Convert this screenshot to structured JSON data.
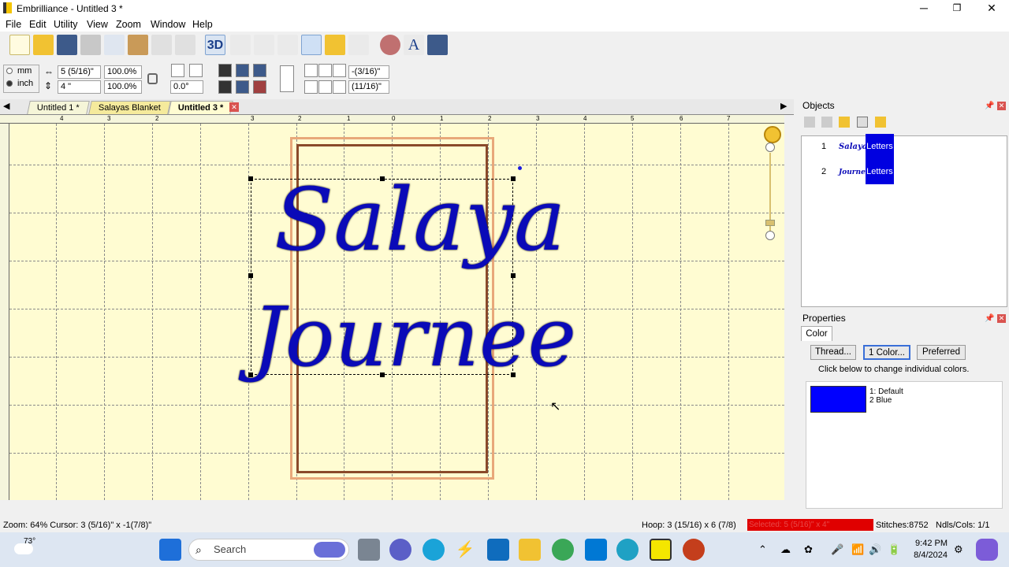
{
  "window": {
    "title": "Embrilliance - Untitled 3 *",
    "minimize": "─",
    "maximize": "❐",
    "close": "✕"
  },
  "menu": [
    "File",
    "Edit",
    "Utility",
    "View",
    "Zoom",
    "Window",
    "Help"
  ],
  "toolbar": {
    "three_d_label": "3D"
  },
  "units": {
    "mm": "mm",
    "inch": "inch",
    "selected": "inch"
  },
  "size": {
    "width": "5 (5/16)\"",
    "height": "4 \"",
    "width_pct": "100.0%",
    "height_pct": "100.0%",
    "rotation": "0.0°"
  },
  "position": {
    "x": "-(3/16)\"",
    "y": "(11/16)\""
  },
  "tabs": [
    "Untitled 1 *",
    "Salayas Blanket",
    "Untitled 3 *"
  ],
  "design": {
    "line1": "Salaya",
    "line2": "Journee",
    "thread_color": "#0a0ab8"
  },
  "ruler": {
    "top": [
      "4",
      "3",
      "2",
      "1",
      "0",
      "1",
      "2",
      "3",
      "4",
      "5",
      "6",
      "7"
    ]
  },
  "objects": {
    "title": "Objects",
    "items": [
      {
        "index": "1",
        "type": "Letters",
        "thumb": "Salaya"
      },
      {
        "index": "2",
        "type": "Letters",
        "thumb": "Journee"
      }
    ]
  },
  "properties": {
    "title": "Properties",
    "tab": "Color",
    "buttons": [
      "Thread...",
      "1 Color...",
      "Preferred"
    ],
    "hint": "Click below to change individual colors.",
    "colors": [
      "1: Default",
      "2 Blue"
    ],
    "swatch": "#0000ff"
  },
  "status": {
    "zoom": "Zoom: 64%  Cursor: 3 (5/16)\" x -1(7/8)\"",
    "hoop": "Hoop: 3 (15/16) x 6 (7/8)",
    "selected": "Selected: 5 (5/16)\" x 4\"",
    "stitches": "Stitches:8752",
    "needles": "Ndls/Cols: 1/1"
  },
  "taskbar": {
    "weather": "73°",
    "search": "Search",
    "time": "9:42 PM",
    "date": "8/4/2024"
  }
}
